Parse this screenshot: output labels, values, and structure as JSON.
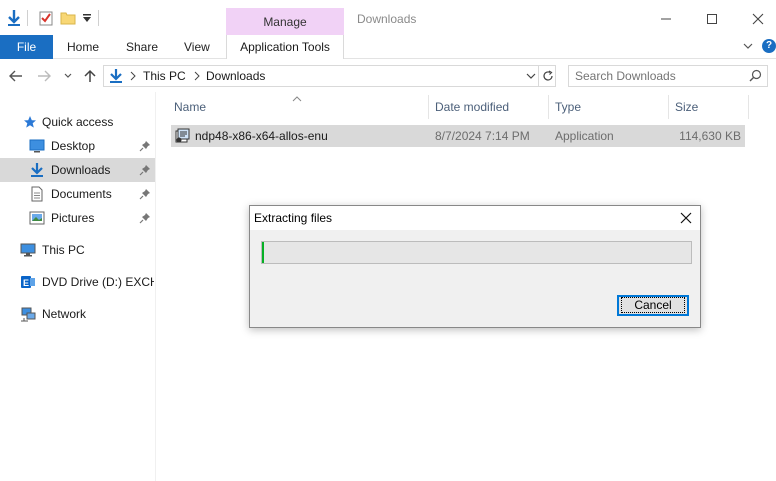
{
  "window": {
    "title": "Downloads",
    "context_tab": "Manage"
  },
  "ribbon": {
    "tabs": [
      "File",
      "Home",
      "Share",
      "View"
    ],
    "context_label": "Application Tools"
  },
  "address": {
    "crumbs": [
      "This PC",
      "Downloads"
    ],
    "search_placeholder": "Search Downloads"
  },
  "sidebar": {
    "items": [
      {
        "label": "Quick access",
        "icon": "star-icon"
      },
      {
        "label": "Desktop",
        "icon": "desktop-folder-icon",
        "pinned": true
      },
      {
        "label": "Downloads",
        "icon": "download-arrow-icon",
        "pinned": true,
        "selected": true
      },
      {
        "label": "Documents",
        "icon": "document-icon",
        "pinned": true
      },
      {
        "label": "Pictures",
        "icon": "pictures-icon",
        "pinned": true
      },
      {
        "label": "This PC",
        "icon": "computer-icon"
      },
      {
        "label": "DVD Drive (D:) EXCHA",
        "icon": "exchange-disc-icon"
      },
      {
        "label": "Network",
        "icon": "network-icon"
      }
    ]
  },
  "filelist": {
    "columns": [
      "Name",
      "Date modified",
      "Type",
      "Size"
    ],
    "rows": [
      {
        "name": "ndp48-x86-x64-allos-enu",
        "date": "8/7/2024 7:14 PM",
        "type": "Application",
        "size": "114,630 KB"
      }
    ]
  },
  "dialog": {
    "title": "Extracting files",
    "progress": 0.0,
    "cancel_label": "Cancel"
  },
  "colors": {
    "file_tab": "#1a6ec2",
    "manage_tab": "#f1d2f6",
    "selection": "#d9d9d9",
    "progress": "#06b025"
  }
}
